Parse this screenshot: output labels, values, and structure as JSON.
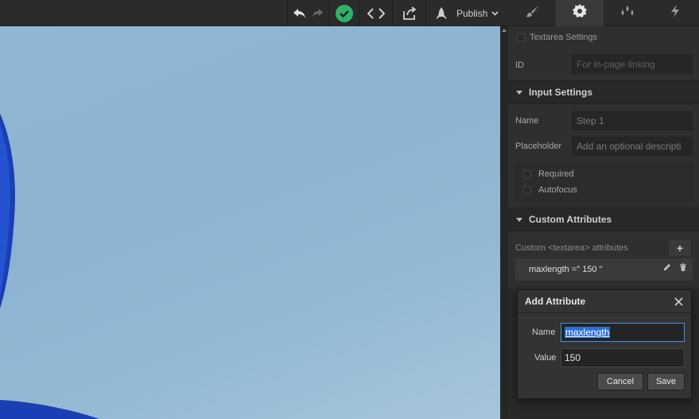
{
  "toolbar": {
    "publish_label": "Publish",
    "icons": {
      "undo": "undo-icon",
      "redo": "redo-icon",
      "status": "check-circle-icon",
      "code": "code-icon",
      "export": "export-icon",
      "publish": "rocket-icon",
      "dropdown": "chevron-down-icon"
    },
    "panel_tabs": [
      "style-brush-icon",
      "settings-gear-icon",
      "interactions-drops-icon",
      "lightning-icon"
    ],
    "colors": {
      "status_green": "#2fb36c"
    }
  },
  "panel": {
    "element_settings_title": "Textarea Settings",
    "id": {
      "label": "ID",
      "placeholder": "For in-page linking"
    },
    "input_settings": {
      "title": "Input Settings",
      "name": {
        "label": "Name",
        "value": "Step 1"
      },
      "placeholder": {
        "label": "Placeholder",
        "value": "Add an optional descripti"
      },
      "required_label": "Required",
      "autofocus_label": "Autofocus"
    },
    "custom_attributes": {
      "title": "Custom Attributes",
      "subtitle": "Custom <textarea> attributes",
      "items": [
        {
          "text": "maxlength =\" 150 \""
        }
      ]
    }
  },
  "modal": {
    "title": "Add Attribute",
    "name_label": "Name",
    "name_value": "maxlength",
    "value_label": "Value",
    "value_value": "150",
    "cancel_label": "Cancel",
    "save_label": "Save"
  }
}
